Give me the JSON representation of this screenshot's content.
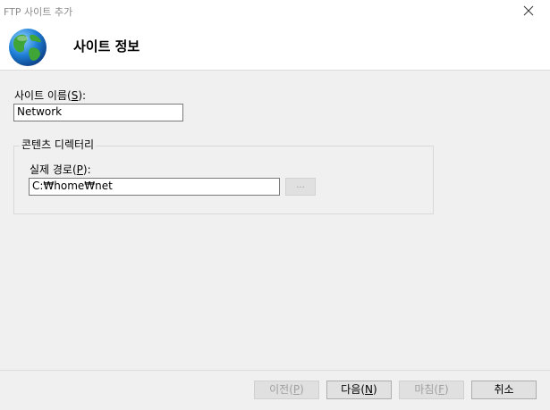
{
  "window": {
    "title": "FTP 사이트 추가"
  },
  "banner": {
    "title": "사이트 정보",
    "icon": "globe-icon"
  },
  "site_name": {
    "label_prefix": "사이트 이름(",
    "label_mnemonic": "S",
    "label_suffix": "):",
    "value": "Network"
  },
  "content_directory": {
    "legend": "콘텐츠 디렉터리",
    "physical_path": {
      "label_prefix": "실제 경로(",
      "label_mnemonic": "P",
      "label_suffix": "):",
      "value": "C:₩home₩net"
    },
    "browse_label": "..."
  },
  "buttons": {
    "previous": {
      "prefix": "이전(",
      "mnemonic": "P",
      "suffix": ")"
    },
    "next": {
      "prefix": "다음(",
      "mnemonic": "N",
      "suffix": ")"
    },
    "finish": {
      "prefix": "마침(",
      "mnemonic": "F",
      "suffix": ")"
    },
    "cancel": {
      "label": "취소"
    }
  }
}
